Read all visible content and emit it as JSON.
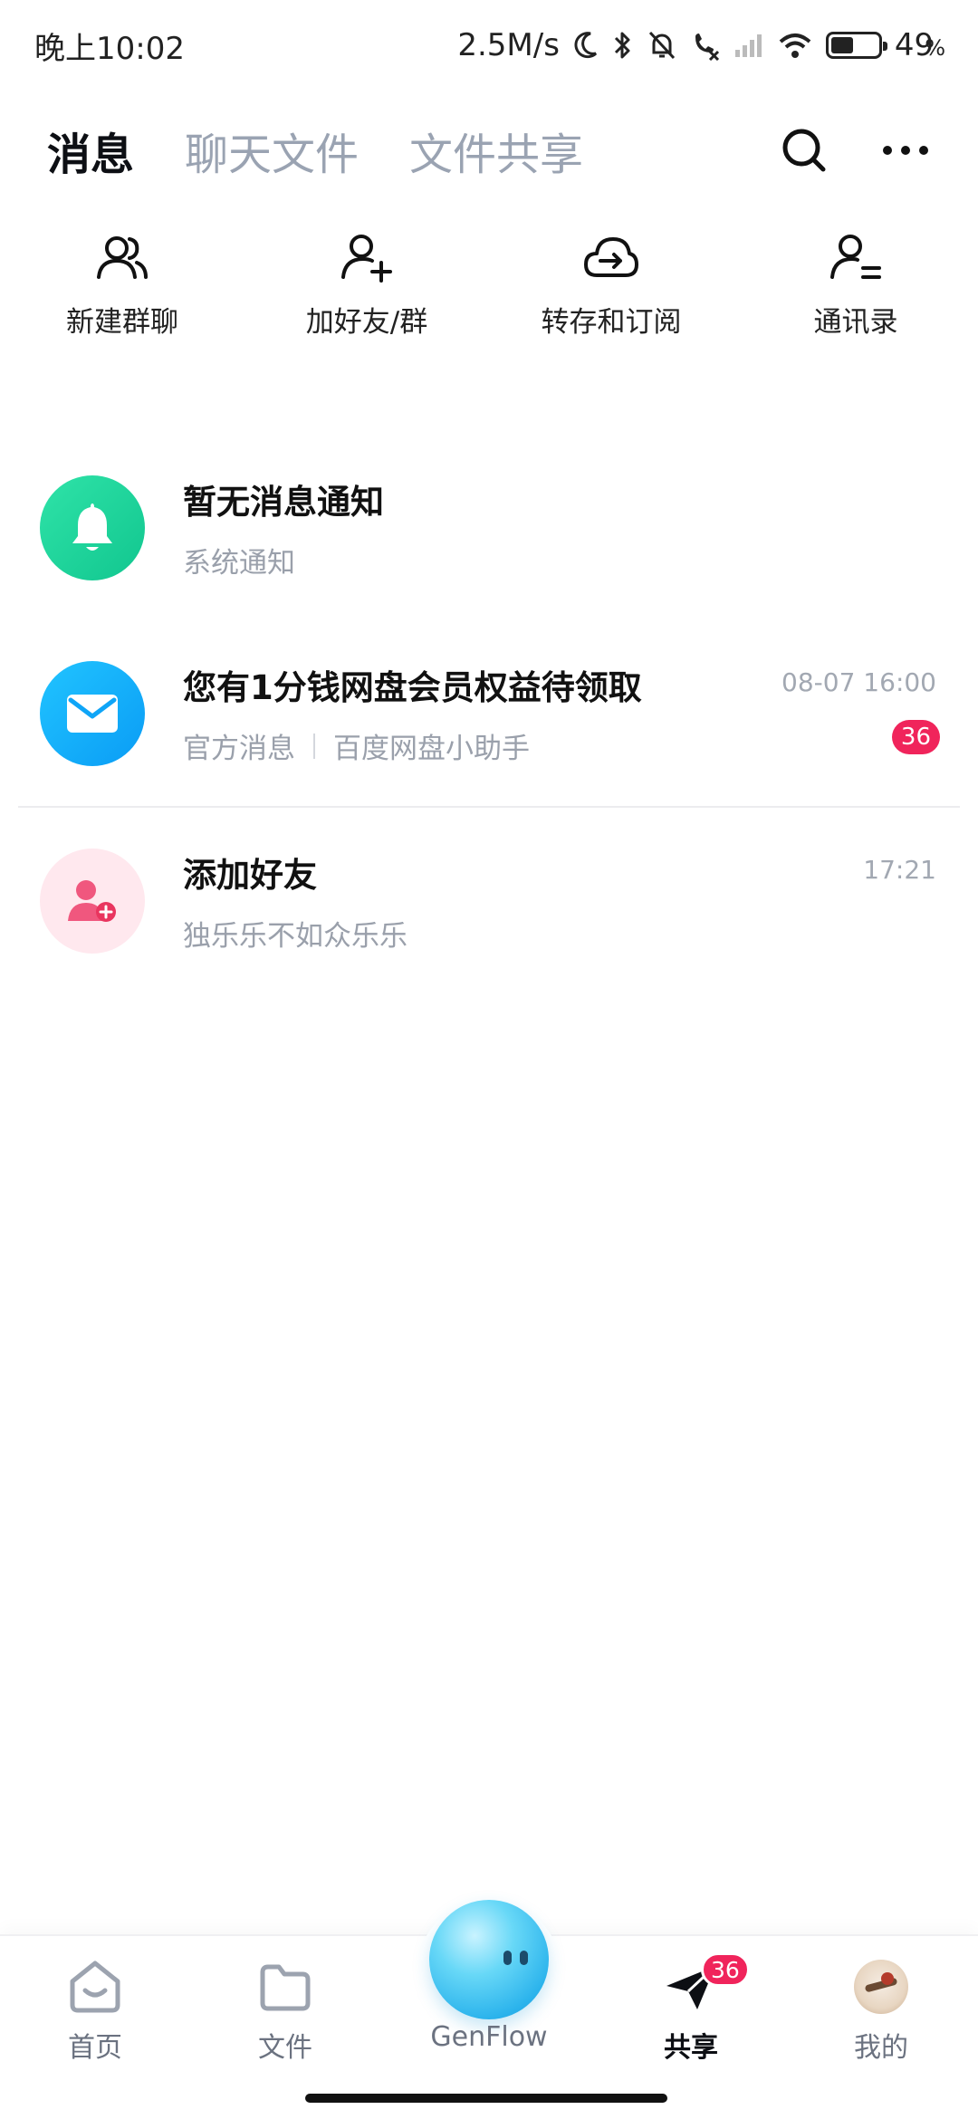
{
  "status_bar": {
    "time": "晚上10:02",
    "network_speed": "2.5M/s",
    "battery_percent": "49",
    "battery_percent_sign": "%",
    "battery_level": 0.49
  },
  "tabs": [
    {
      "label": "消息",
      "active": true
    },
    {
      "label": "聊天文件",
      "active": false
    },
    {
      "label": "文件共享",
      "active": false
    }
  ],
  "quick_actions": [
    {
      "label": "新建群聊",
      "icon": "group-chat-icon"
    },
    {
      "label": "加好友/群",
      "icon": "add-friend-icon"
    },
    {
      "label": "转存和订阅",
      "icon": "cloud-transfer-icon"
    },
    {
      "label": "通讯录",
      "icon": "contacts-icon"
    }
  ],
  "messages": [
    {
      "title": "暂无消息通知",
      "subtitle": "系统通知",
      "time": "",
      "badge": "",
      "icon": "bell-icon"
    },
    {
      "title": "您有1分钱网盘会员权益待领取",
      "subtitle_source": "官方消息",
      "subtitle": "百度网盘小助手",
      "time": "08-07 16:00",
      "badge": "36",
      "icon": "mail-icon"
    },
    {
      "title": "添加好友",
      "subtitle": "独乐乐不如众乐乐",
      "time": "17:21",
      "badge": "",
      "icon": "add-user-icon"
    }
  ],
  "bottom_nav": {
    "items": [
      {
        "label": "首页",
        "icon": "home-icon"
      },
      {
        "label": "文件",
        "icon": "folder-icon"
      },
      {
        "label": "GenFlow",
        "icon": "genflow-assistant-icon"
      },
      {
        "label": "共享",
        "icon": "share-paper-plane-icon",
        "badge": "36",
        "active": true
      },
      {
        "label": "我的",
        "icon": "profile-avatar"
      }
    ]
  },
  "colors": {
    "accent_badge": "#f0245b",
    "text_primary": "#111111",
    "text_secondary": "#9aa0ab",
    "bell_avatar": "#1fd49c",
    "mail_avatar": "#14b2fa",
    "friend_avatar_bg": "#ffe8ee"
  }
}
